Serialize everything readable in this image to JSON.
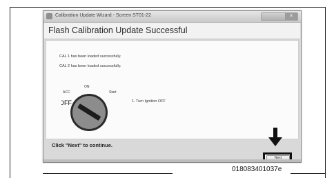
{
  "window": {
    "title": "Calibration Update Wizard - Screen ST01-22"
  },
  "header": {
    "heading": "Flash Calibration Update Successful"
  },
  "messages": [
    "CAL 1 has been loaded successfully.",
    "CAL 2 has been loaded successfully."
  ],
  "ignition": {
    "labels": {
      "acc": "ACC",
      "on": "ON",
      "start": "Start",
      "off": "OFF"
    },
    "instruction": "1. Turn Ignition OFF"
  },
  "footer": {
    "instruction": "Click \"Next\" to continue.",
    "next_label": "Next"
  },
  "figure": {
    "caption": "018083401037e"
  },
  "icons": {
    "app": "app-icon",
    "close": "close-icon",
    "arrow": "down-arrow-icon",
    "ignition": "ignition-switch-icon"
  }
}
